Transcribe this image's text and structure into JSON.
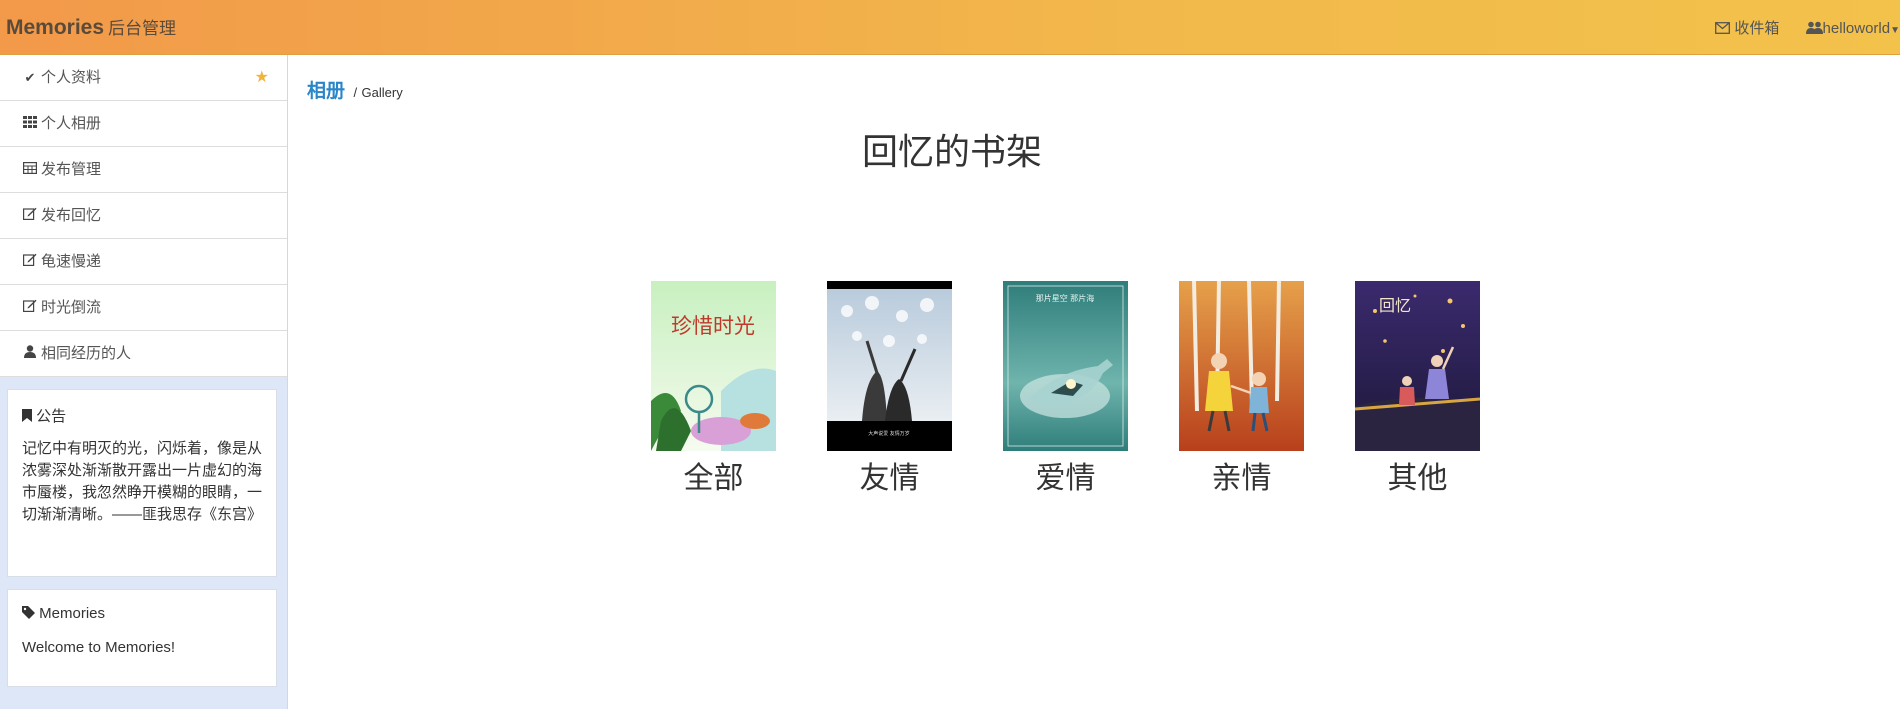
{
  "header": {
    "brand_main": "Memories",
    "brand_sub": "后台管理",
    "inbox_label": "收件箱",
    "user_label": "helloworld"
  },
  "sidebar": {
    "items": [
      {
        "label": "个人资料",
        "icon": "check-icon"
      },
      {
        "label": "个人相册",
        "icon": "grid-icon"
      },
      {
        "label": "发布管理",
        "icon": "table-icon"
      },
      {
        "label": "发布回忆",
        "icon": "edit-icon"
      },
      {
        "label": "龟速慢递",
        "icon": "edit-icon"
      },
      {
        "label": "时光倒流",
        "icon": "edit-icon"
      },
      {
        "label": "相同经历的人",
        "icon": "user-icon"
      }
    ],
    "notice": {
      "title": "公告",
      "text": "记忆中有明灭的光，闪烁着，像是从浓雾深处渐渐散开露出一片虚幻的海市蜃楼，我忽然睁开模糊的眼睛，一切渐渐清晰。——匪我思存《东宫》"
    },
    "memories": {
      "title": "Memories",
      "text": "Welcome to Memories!"
    }
  },
  "main": {
    "breadcrumb_primary": "相册",
    "breadcrumb_separator": "/",
    "breadcrumb_secondary": "Gallery",
    "title": "回忆的书架",
    "albums": [
      {
        "label": "全部",
        "cover_text": "珍惜时光"
      },
      {
        "label": "友情",
        "cover_text": "大声说爱 友情万岁"
      },
      {
        "label": "爱情",
        "cover_text": "那片星空 那片海"
      },
      {
        "label": "亲情",
        "cover_text": ""
      },
      {
        "label": "其他",
        "cover_text": "回忆"
      }
    ]
  },
  "colors": {
    "header_gradient_start": "#f2994a",
    "header_gradient_end": "#f3c24b",
    "breadcrumb_accent": "#2a86c8",
    "star": "#f2b33d",
    "sidebar_bg": "#dde7f7"
  }
}
